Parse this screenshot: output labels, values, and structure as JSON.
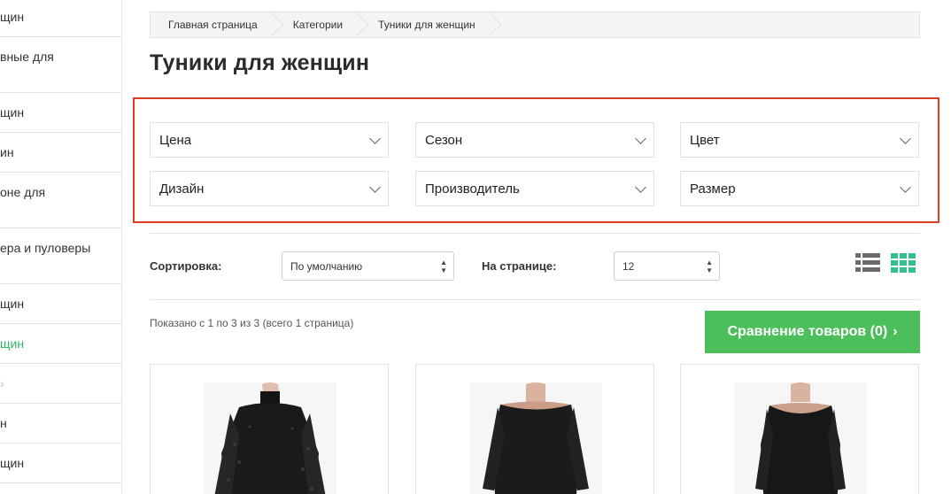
{
  "sidebar": {
    "items": [
      {
        "label": "щин"
      },
      {
        "label": "вные для"
      },
      {
        "label": "щин"
      },
      {
        "label": "ин"
      },
      {
        "label": "оне для"
      },
      {
        "label": "ера и пуловеры"
      },
      {
        "label": "щин"
      },
      {
        "label": "щин",
        "active": true
      },
      {
        "label": ""
      },
      {
        "label": "н"
      },
      {
        "label": "щин"
      }
    ]
  },
  "breadcrumb": [
    "Главная страница",
    "Категории",
    "Туники для женщин"
  ],
  "page_title": "Туники для женщин",
  "filters": {
    "price": "Цена",
    "season": "Сезон",
    "color": "Цвет",
    "design": "Дизайн",
    "manufacturer": "Производитель",
    "size": "Размер"
  },
  "sort": {
    "label": "Сортировка:",
    "value": "По умолчанию"
  },
  "per_page": {
    "label": "На странице:",
    "value": "12"
  },
  "showing_text": "Показано с 1 по 3 из 3 (всего 1 страница)",
  "compare_button": {
    "label": "Сравнение товаров (0)",
    "arrow": "›"
  },
  "colors": {
    "accent_green": "#4cbf5a",
    "grid_icon": "#35c08b",
    "highlight_border": "#e03a22",
    "active_link": "#2db368"
  },
  "products": [
    {
      "image": "black-lace-tunic"
    },
    {
      "image": "black-tunic"
    },
    {
      "image": "black-tunic-sleeveless"
    }
  ]
}
